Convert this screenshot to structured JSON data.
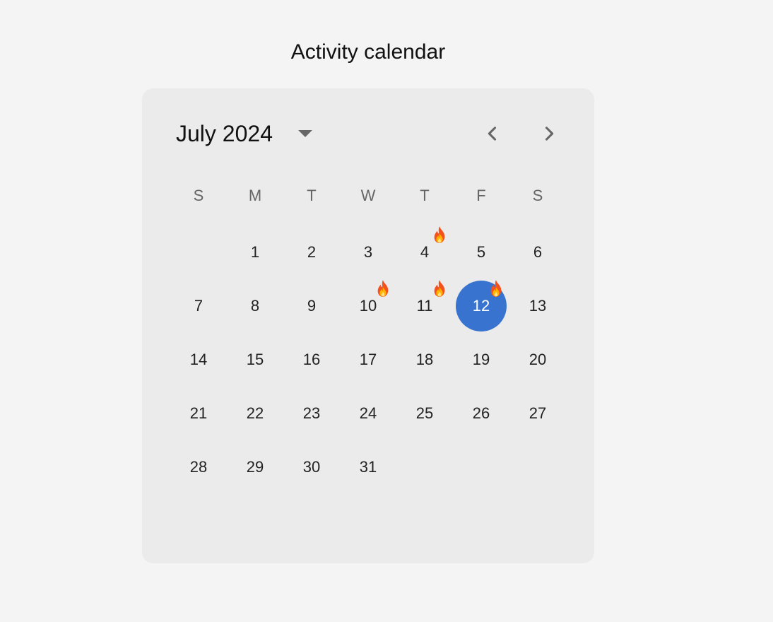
{
  "page": {
    "title": "Activity calendar"
  },
  "calendar": {
    "month_label": "July 2024",
    "prev_icon": "chevron-left-icon",
    "next_icon": "chevron-right-icon",
    "dropdown_icon": "caret-down-icon",
    "weekdays": [
      "S",
      "M",
      "T",
      "W",
      "T",
      "F",
      "S"
    ],
    "leading_blank_days": 1,
    "days": [
      "1",
      "2",
      "3",
      "4",
      "5",
      "6",
      "7",
      "8",
      "9",
      "10",
      "11",
      "12",
      "13",
      "14",
      "15",
      "16",
      "17",
      "18",
      "19",
      "20",
      "21",
      "22",
      "23",
      "24",
      "25",
      "26",
      "27",
      "28",
      "29",
      "30",
      "31"
    ],
    "selected_day": "12",
    "activity_days": [
      "4",
      "10",
      "11",
      "12"
    ],
    "activity_icon": "fire-icon",
    "colors": {
      "selected": "#3874cf",
      "card_background": "#ebebeb",
      "page_background": "#f4f4f4"
    }
  }
}
